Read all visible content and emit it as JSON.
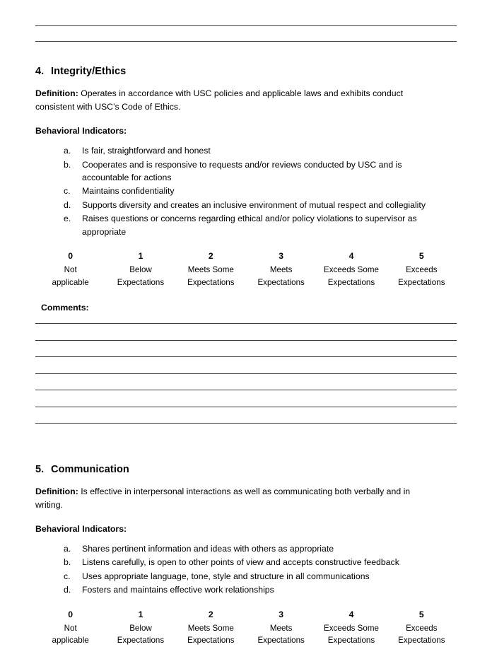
{
  "top_blank_lines": {
    "count": 2,
    "description": "blank write-in rules continuing previous section"
  },
  "sections": [
    {
      "number": "4.",
      "title": "Integrity/Ethics",
      "definition_label": "Definition:",
      "definition_text": "Operates in accordance with USC policies and applicable laws and exhibits conduct consistent with USC’s Code of Ethics.",
      "indicators_label": "Behavioral Indicators:",
      "indicators": [
        {
          "marker": "a.",
          "text": "Is fair, straightforward and honest"
        },
        {
          "marker": "b.",
          "text": "Cooperates and is responsive to requests and/or reviews conducted by USC and is accountable for actions"
        },
        {
          "marker": "c.",
          "text": "Maintains confidentiality"
        },
        {
          "marker": "d.",
          "text": "Supports diversity and creates an inclusive environment of mutual respect and collegiality"
        },
        {
          "marker": "e.",
          "text": "Raises questions or concerns regarding ethical and/or policy violations to supervisor as appropriate"
        }
      ],
      "scale": [
        {
          "num": "0",
          "label": "Not\napplicable"
        },
        {
          "num": "1",
          "label": "Below\nExpectations"
        },
        {
          "num": "2",
          "label": "Meets Some\nExpectations"
        },
        {
          "num": "3",
          "label": "Meets\nExpectations"
        },
        {
          "num": "4",
          "label": "Exceeds Some\nExpectations"
        },
        {
          "num": "5",
          "label": "Exceeds\nExpectations"
        }
      ],
      "comments_label": "Comments:",
      "comment_line_count": 7
    },
    {
      "number": "5.",
      "title": "Communication",
      "definition_label": "Definition:",
      "definition_text": "Is effective in interpersonal interactions as well as communicating both verbally and in writing.",
      "indicators_label": "Behavioral Indicators:",
      "indicators": [
        {
          "marker": "a.",
          "text": "Shares pertinent information and ideas with others as appropriate"
        },
        {
          "marker": "b.",
          "text": "Listens carefully, is open to other points of view and accepts constructive feedback"
        },
        {
          "marker": "c.",
          "text": "Uses appropriate language, tone, style and structure in all communications"
        },
        {
          "marker": "d.",
          "text": "Fosters and maintains effective work relationships"
        }
      ],
      "scale": [
        {
          "num": "0",
          "label": "Not\napplicable"
        },
        {
          "num": "1",
          "label": "Below\nExpectations"
        },
        {
          "num": "2",
          "label": "Meets Some\nExpectations"
        },
        {
          "num": "3",
          "label": "Meets\nExpectations"
        },
        {
          "num": "4",
          "label": "Exceeds Some\nExpectations"
        },
        {
          "num": "5",
          "label": "Exceeds\nExpectations"
        }
      ]
    }
  ],
  "colors": {
    "text": "#000000",
    "rule": "#3b3b3b",
    "page_background": "#ffffff"
  }
}
